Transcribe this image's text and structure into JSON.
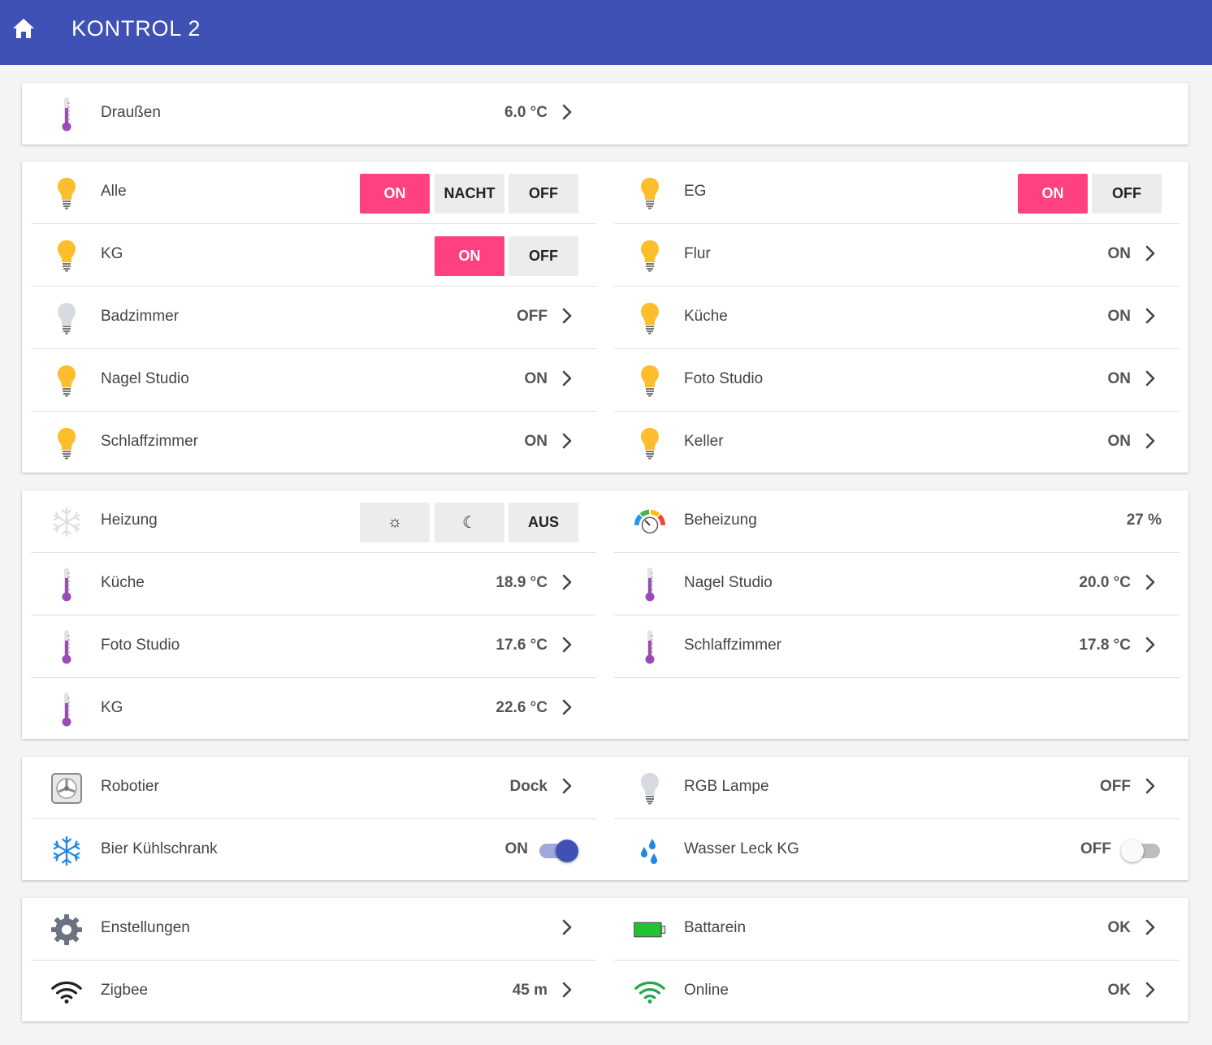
{
  "header": {
    "title": "KONTROL 2",
    "home_icon": "home-icon"
  },
  "colors": {
    "primary": "#3f51b5",
    "accent": "#ff4081",
    "bulb_on": "#fdbd2c",
    "bulb_off": "#d7dbdf",
    "thermo": "#9c4ab5"
  },
  "outside": {
    "label": "Draußen",
    "value": "6.0 °C"
  },
  "lights": {
    "left": [
      {
        "label": "Alle",
        "buttons": [
          "ON",
          "NACHT",
          "OFF"
        ]
      },
      {
        "label": "KG",
        "buttons": [
          "ON",
          "OFF"
        ]
      },
      {
        "label": "Badzimmer",
        "value": "OFF"
      },
      {
        "label": "Nagel Studio",
        "value": "ON"
      },
      {
        "label": "Schlaffzimmer",
        "value": "ON"
      }
    ],
    "right": [
      {
        "label": "EG",
        "buttons": [
          "ON",
          "OFF"
        ]
      },
      {
        "label": "Flur",
        "value": "ON"
      },
      {
        "label": "Küche",
        "value": "ON"
      },
      {
        "label": "Foto Studio",
        "value": "ON"
      },
      {
        "label": "Keller",
        "value": "ON"
      }
    ]
  },
  "heating": {
    "left": [
      {
        "label": "Heizung",
        "buttons": [
          "☼",
          "☾",
          "AUS"
        ]
      },
      {
        "label": "Küche",
        "value": "18.9 °C"
      },
      {
        "label": "Foto Studio",
        "value": "17.6 °C"
      },
      {
        "label": "KG",
        "value": "22.6 °C"
      }
    ],
    "right": [
      {
        "label": "Beheizung",
        "value": "27 %"
      },
      {
        "label": "Nagel Studio",
        "value": "20.0 °C"
      },
      {
        "label": "Schlaffzimmer",
        "value": "17.8 °C"
      }
    ]
  },
  "devices": {
    "left": [
      {
        "label": "Robotier",
        "value": "Dock"
      },
      {
        "label": "Bier Kühlschrank",
        "value": "ON",
        "toggle": true
      }
    ],
    "right": [
      {
        "label": "RGB Lampe",
        "value": "OFF"
      },
      {
        "label": "Wasser Leck KG",
        "value": "OFF",
        "toggle": false
      }
    ]
  },
  "system": {
    "left": [
      {
        "label": "Enstellungen",
        "value": ""
      },
      {
        "label": "Zigbee",
        "value": "45 m"
      }
    ],
    "right": [
      {
        "label": "Battarein",
        "value": "OK"
      },
      {
        "label": "Online",
        "value": "OK"
      }
    ]
  }
}
